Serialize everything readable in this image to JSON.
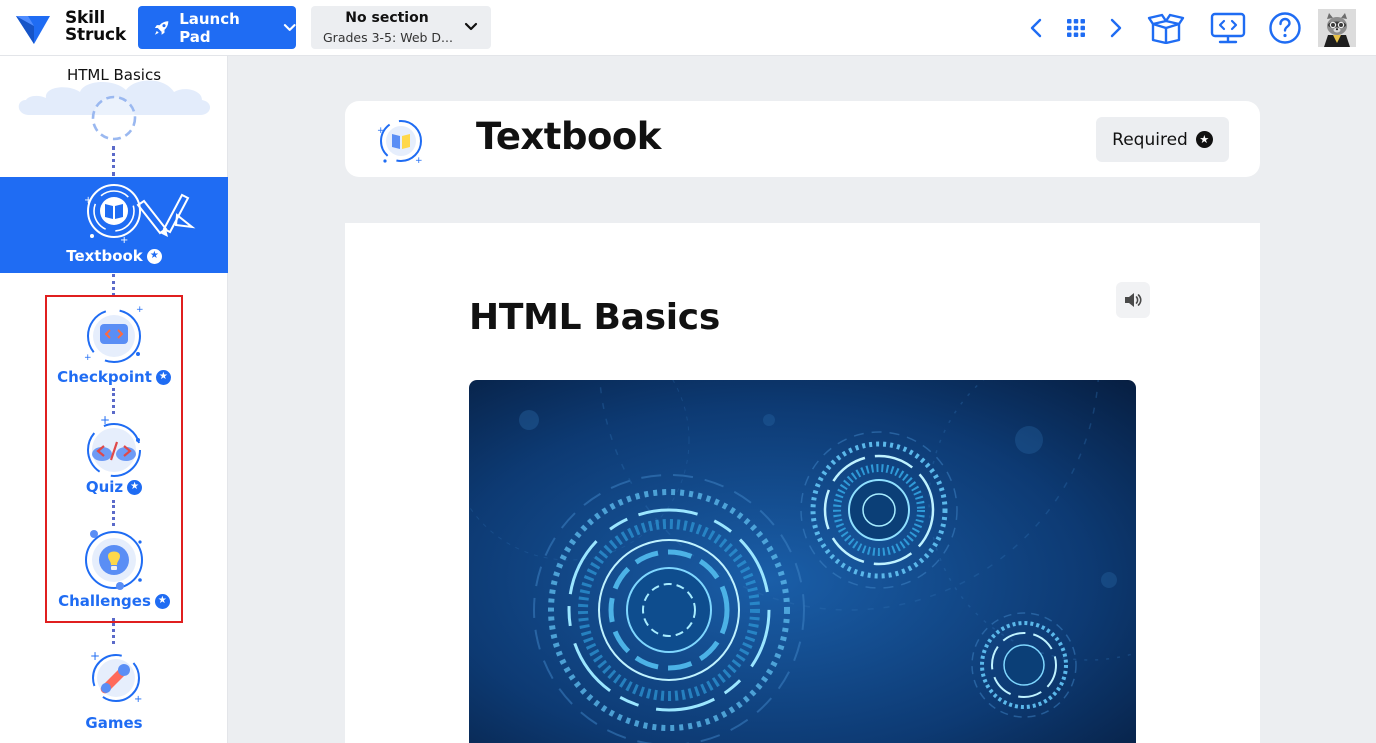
{
  "brand": {
    "name_line1": "Skill",
    "name_line2": "Struck",
    "color": "#1f6cf3"
  },
  "topbar": {
    "launch_label": "Launch Pad",
    "section_title": "No section",
    "section_subtitle": "Grades 3-5: Web D...",
    "icons": [
      "chevron-left-icon",
      "grid-icon",
      "chevron-right-icon",
      "gift-box-icon",
      "screen-code-icon",
      "help-icon"
    ]
  },
  "sidebar": {
    "title": "HTML Basics",
    "items": [
      {
        "label": "Textbook",
        "active": true,
        "required": true
      },
      {
        "label": "Checkpoint",
        "active": false,
        "required": true
      },
      {
        "label": "Quiz",
        "active": false,
        "required": true
      },
      {
        "label": "Challenges",
        "active": false,
        "required": true
      },
      {
        "label": "Games",
        "active": false,
        "required": false
      }
    ]
  },
  "header": {
    "title": "Textbook",
    "required_label": "Required"
  },
  "content": {
    "title": "HTML Basics"
  },
  "colors": {
    "accent": "#1f6cf3",
    "highlight": "#e01f1f",
    "background": "#eceef1"
  }
}
